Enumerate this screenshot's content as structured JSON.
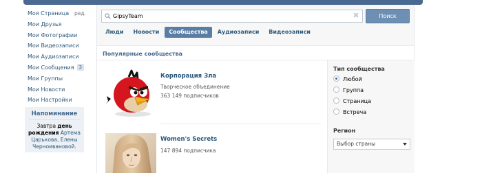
{
  "sidebar": {
    "edit_label": "ред.",
    "items": [
      {
        "label": "Моя Страница"
      },
      {
        "label": "Мои Друзья"
      },
      {
        "label": "Мои Фотографии"
      },
      {
        "label": "Мои Видеозаписи"
      },
      {
        "label": "Мои Аудиозаписи"
      },
      {
        "label": "Мои Сообщения",
        "badge": "3"
      },
      {
        "label": "Мои Группы"
      },
      {
        "label": "Мои Новости"
      },
      {
        "label": "Мои Настройки"
      }
    ]
  },
  "reminder": {
    "title": "Напоминание",
    "text_1": "Завтра ",
    "text_bold": "день рождения",
    "text_2": " ",
    "names": "Артема Царькова, Елены Черноивановой."
  },
  "search": {
    "value": "GipsyTeam",
    "button_label": "Поиск"
  },
  "tabs": [
    {
      "label": "Люди",
      "active": false
    },
    {
      "label": "Новости",
      "active": false
    },
    {
      "label": "Сообщества",
      "active": true
    },
    {
      "label": "Аудиозаписи",
      "active": false
    },
    {
      "label": "Видеозаписи",
      "active": false
    }
  ],
  "section_title": "Популярные сообщества",
  "groups": [
    {
      "name": "Корпорация Зла",
      "type": "Творческое объединение",
      "subscribers": "363 149 подписчиков",
      "avatar": "angry-bird-icon"
    },
    {
      "name": "Women's Secrets",
      "type": "",
      "subscribers": "147 894 подписчика",
      "avatar": "woman-photo"
    }
  ],
  "filters": {
    "type_title": "Тип сообщества",
    "type_options": [
      {
        "label": "Любой",
        "selected": true
      },
      {
        "label": "Группа",
        "selected": false
      },
      {
        "label": "Страница",
        "selected": false
      },
      {
        "label": "Встреча",
        "selected": false
      }
    ],
    "region_title": "Регион",
    "region_select": "Выбор страны"
  },
  "colors": {
    "link": "#2b587a",
    "accent": "#597da3",
    "button": "#6d8fb3"
  }
}
